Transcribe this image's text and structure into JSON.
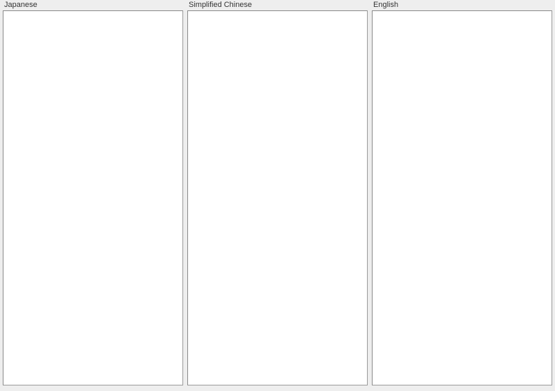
{
  "columns": [
    {
      "label": "Japanese",
      "value": ""
    },
    {
      "label": "Simplified Chinese",
      "value": ""
    },
    {
      "label": "English",
      "value": ""
    }
  ]
}
